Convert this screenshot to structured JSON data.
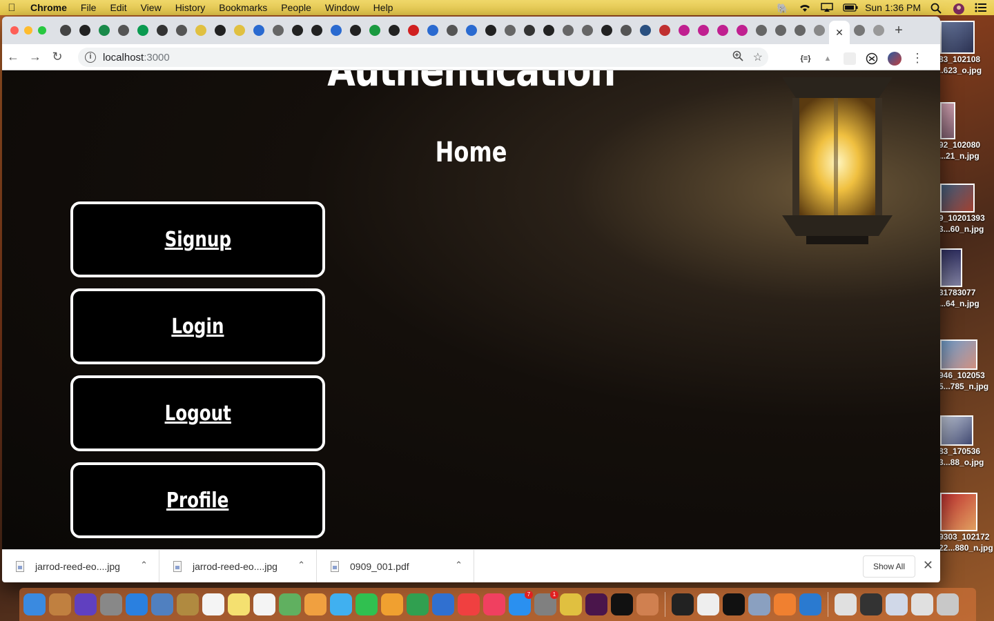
{
  "menubar": {
    "apple_icon": "apple-icon",
    "items": [
      "Chrome",
      "File",
      "Edit",
      "View",
      "History",
      "Bookmarks",
      "People",
      "Window",
      "Help"
    ],
    "clock": "Sun 1:36 PM"
  },
  "desktop_files": [
    {
      "name_line1": "83_102108",
      "name_line2": "..623_o.jpg"
    },
    {
      "name_line1": "92_102080",
      "name_line2": "...21_n.jpg"
    },
    {
      "name_line1": "9_10201393",
      "name_line2": "3...60_n.jpg"
    },
    {
      "name_line1": "31783077",
      "name_line2": "...64_n.jpg"
    },
    {
      "name_line1": "946_102053",
      "name_line2": "5...785_n.jpg"
    },
    {
      "name_line1": "83_170536",
      "name_line2": "3...88_o.jpg"
    },
    {
      "name_line1": "9303_102172",
      "name_line2": "22...880_n.jpg"
    }
  ],
  "browser": {
    "address": {
      "host": "localhost",
      "port": ":3000"
    }
  },
  "page": {
    "heading": "Authentication",
    "subheading": "Home",
    "nav_links": [
      "Signup",
      "Login",
      "Logout",
      "Profile"
    ]
  },
  "downloads": {
    "items": [
      "jarrod-reed-eo....jpg",
      "jarrod-reed-eo....jpg",
      "0909_001.pdf"
    ],
    "show_all": "Show All"
  },
  "dock": {
    "badges": {
      "app_store": "7",
      "system_prefs": "1"
    }
  }
}
